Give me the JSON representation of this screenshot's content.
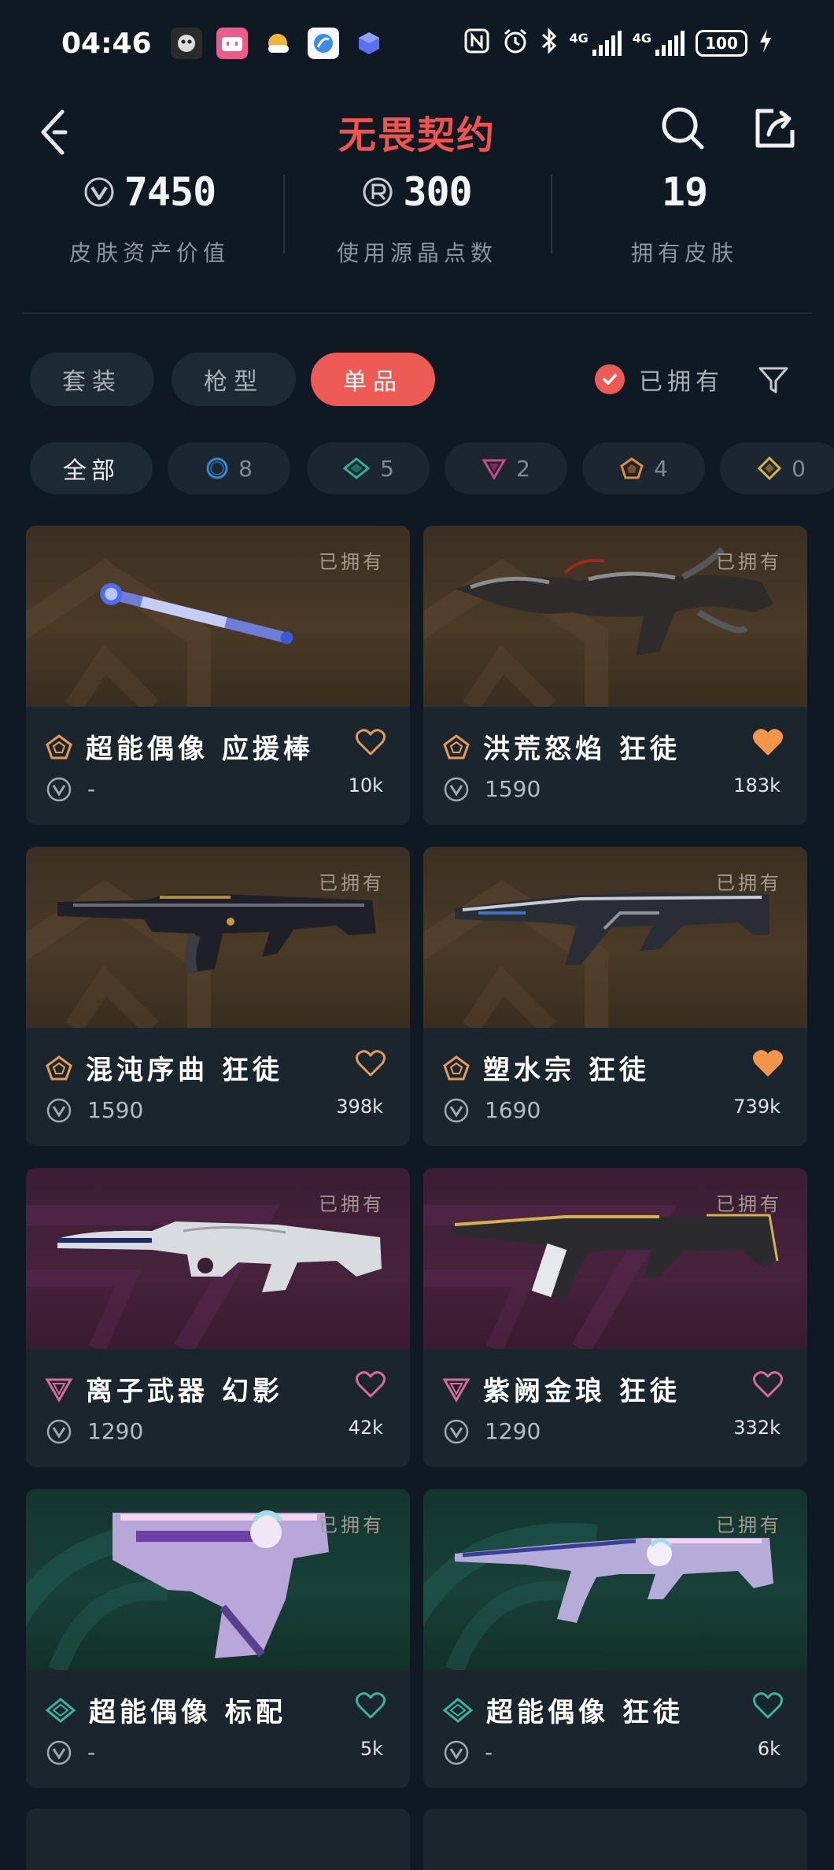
{
  "status_bar": {
    "time": "04:46",
    "network_1": "4G",
    "network_2": "4G",
    "battery": "100"
  },
  "header": {
    "title": "无畏契约"
  },
  "stats": [
    {
      "value": "7450",
      "label": "皮肤资产价值",
      "icon": "vp-coin-icon"
    },
    {
      "value": "300",
      "label": "使用源晶点数",
      "icon": "radianite-icon"
    },
    {
      "value": "19",
      "label": "拥有皮肤",
      "icon": ""
    }
  ],
  "tabs": {
    "items": [
      "套装",
      "枪型",
      "单品"
    ],
    "active": "单品",
    "owned_toggle": "已拥有"
  },
  "rarity_filters": {
    "all": "全部",
    "items": [
      {
        "tier": "select",
        "count": "8",
        "color": "#2f6fb0"
      },
      {
        "tier": "deluxe",
        "count": "5",
        "color": "#1f8f7f"
      },
      {
        "tier": "premium",
        "count": "2",
        "color": "#b0407a"
      },
      {
        "tier": "exclusive",
        "count": "4",
        "color": "#d38a3a"
      },
      {
        "tier": "ultra",
        "count": "0",
        "color": "#d9b24a"
      }
    ]
  },
  "colors": {
    "accent": "#ee5b55",
    "background": "#0f1923",
    "exclusive": "#e49a5a",
    "premium": "#d96a9b",
    "deluxe": "#3bb39e"
  },
  "skins": [
    {
      "owned_label": "已拥有",
      "name": "超能偶像 应援棒",
      "price": "-",
      "likes": "10k",
      "tier": "exclusive",
      "favorited": false
    },
    {
      "owned_label": "已拥有",
      "name": "洪荒怒焰 狂徒",
      "price": "1590",
      "likes": "183k",
      "tier": "exclusive",
      "favorited": true
    },
    {
      "owned_label": "已拥有",
      "name": "混沌序曲 狂徒",
      "price": "1590",
      "likes": "398k",
      "tier": "exclusive",
      "favorited": false
    },
    {
      "owned_label": "已拥有",
      "name": "塑水宗 狂徒",
      "price": "1690",
      "likes": "739k",
      "tier": "exclusive",
      "favorited": true
    },
    {
      "owned_label": "已拥有",
      "name": "离子武器 幻影",
      "price": "1290",
      "likes": "42k",
      "tier": "premium",
      "favorited": false
    },
    {
      "owned_label": "已拥有",
      "name": "紫阙金琅 狂徒",
      "price": "1290",
      "likes": "332k",
      "tier": "premium",
      "favorited": false
    },
    {
      "owned_label": "已拥有",
      "name": "超能偶像 标配",
      "price": "-",
      "likes": "5k",
      "tier": "deluxe",
      "favorited": false
    },
    {
      "owned_label": "已拥有",
      "name": "超能偶像 狂徒",
      "price": "-",
      "likes": "6k",
      "tier": "deluxe",
      "favorited": false
    }
  ]
}
